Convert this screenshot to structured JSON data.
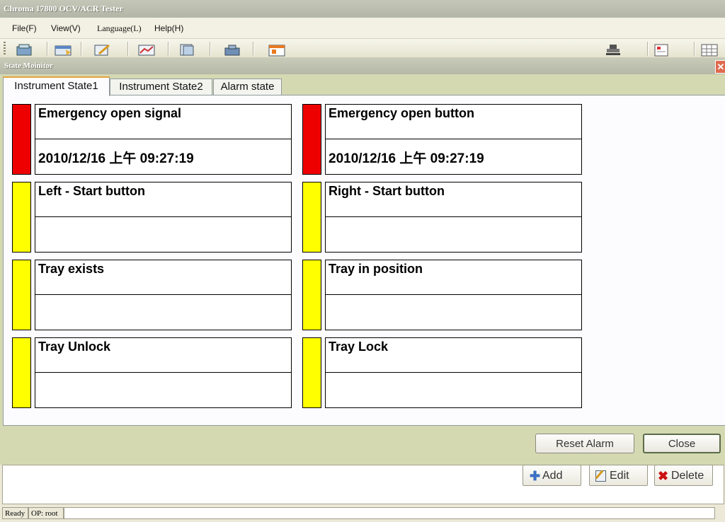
{
  "app": {
    "title": "Chroma 17800 OCV/ACR Tester"
  },
  "menu": [
    "File(F)",
    "View(V)",
    "Language(L)",
    "Help(H)"
  ],
  "toolbar": {
    "icons": [
      "tester-icon",
      "config-icon",
      "edit-icon",
      "chart-icon",
      "report-icon",
      "device-icon",
      "calendar-icon",
      "stamp-icon",
      "sheet-icon",
      "grid-icon"
    ]
  },
  "dialog": {
    "title": "State Moinitor",
    "close_label": "✕",
    "tabs": [
      "Instrument State1",
      "Instrument State2",
      "Alarm state"
    ],
    "active_tab": "Instrument State1",
    "states": [
      {
        "name": "Emergency open signal",
        "time": "2010/12/16 上午 09:27:19",
        "status": "alarm"
      },
      {
        "name": "Emergency open button",
        "time": "2010/12/16 上午 09:27:19",
        "status": "alarm"
      },
      {
        "name": "Left - Start button",
        "time": "",
        "status": "idle"
      },
      {
        "name": "Right - Start button",
        "time": "",
        "status": "idle"
      },
      {
        "name": "Tray exists",
        "time": "",
        "status": "idle"
      },
      {
        "name": "Tray in position",
        "time": "",
        "status": "idle"
      },
      {
        "name": "Tray Unlock",
        "time": "",
        "status": "idle"
      },
      {
        "name": "Tray Lock",
        "time": "",
        "status": "idle"
      }
    ],
    "buttons": {
      "reset_alarm": "Reset Alarm",
      "close": "Close"
    }
  },
  "actions": {
    "add": "Add",
    "edit": "Edit",
    "delete": "Delete"
  },
  "status": {
    "ready": "Ready",
    "operator": "OP:  root"
  },
  "colors": {
    "alarm": "#ee0000",
    "idle": "#ffff00"
  }
}
